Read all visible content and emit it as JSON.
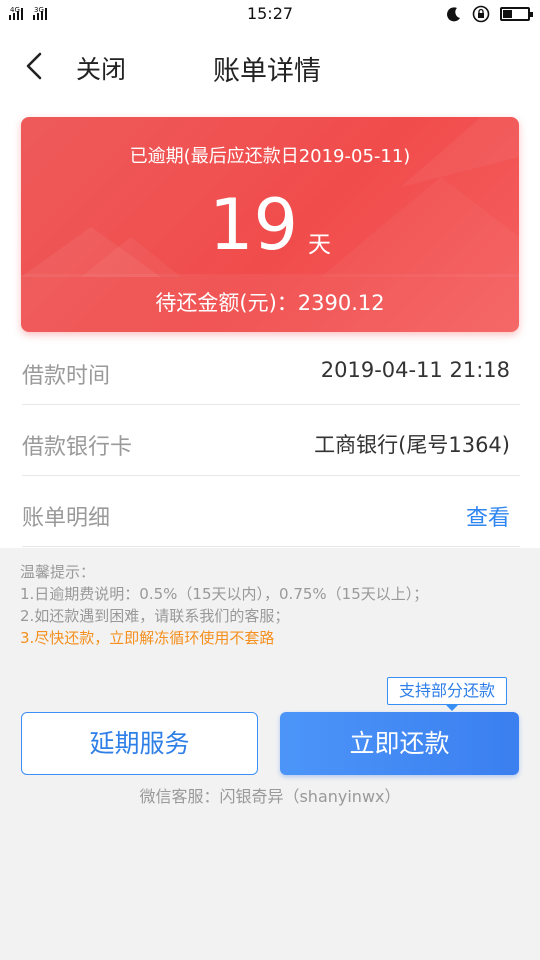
{
  "status_bar": {
    "time": "15:27",
    "network_1": "4G",
    "network_2": "3G",
    "icons": [
      "moon-icon",
      "rotation-lock-icon",
      "battery-icon"
    ]
  },
  "nav": {
    "back_icon": "chevron-left-icon",
    "close_label": "关闭",
    "title": "账单详情"
  },
  "overdue_card": {
    "due_text": "已逾期(最后应还款日2019-05-11)",
    "days": "19",
    "days_unit": "天",
    "amount_line": "待还金额(元)：2390.12"
  },
  "rows": [
    {
      "label": "借款时间",
      "value": "2019-04-11 21:18"
    },
    {
      "label": "借款银行卡",
      "value": "工商银行(尾号1364)"
    },
    {
      "label": "账单明细",
      "link": "查看"
    }
  ],
  "tips": {
    "title": "温馨提示：",
    "line1": "1.日逾期费说明：0.5%（15天以内），0.75%（15天以上）；",
    "line2": "2.如还款遇到困难，请联系我们的客服；",
    "line3": "3.尽快还款，立即解冻循环使用不套路"
  },
  "actions": {
    "partial_tag": "支持部分还款",
    "extend_label": "延期服务",
    "pay_label": "立即还款"
  },
  "wechat_service": "微信客服：闪银奇异（shanyinwx）",
  "colors": {
    "card_red": "#f14c4c",
    "accent_blue": "#2f86f0",
    "warn_orange": "#f5901f"
  }
}
